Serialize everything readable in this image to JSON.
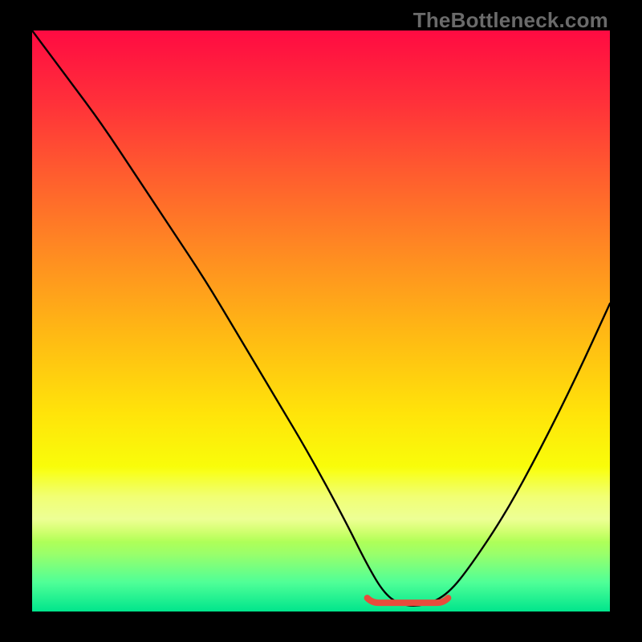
{
  "watermark": {
    "text": "TheBottleneck.com"
  },
  "colors": {
    "frame": "#000000",
    "curve_stroke": "#000000",
    "marker_stroke": "#e74c3c",
    "gradient_top": "#ff0b42",
    "gradient_bottom": "#00e58c"
  },
  "chart_data": {
    "type": "line",
    "title": "",
    "xlabel": "",
    "ylabel": "",
    "xlim": [
      0,
      100
    ],
    "ylim": [
      0,
      100
    ],
    "series": [
      {
        "name": "bottleneck-curve",
        "x_pct": [
          0,
          6,
          12,
          18,
          24,
          30,
          36,
          42,
          48,
          54,
          58,
          61,
          64,
          68,
          72,
          76,
          82,
          88,
          94,
          100
        ],
        "y_pct": [
          100,
          92,
          84,
          75,
          66,
          57,
          47,
          37,
          27,
          16,
          8,
          3,
          1,
          1,
          3,
          8,
          17,
          28,
          40,
          53
        ]
      }
    ],
    "marker": {
      "name": "optimal-range",
      "x_start_pct": 58,
      "x_end_pct": 72,
      "y_pct": 1.5
    }
  }
}
